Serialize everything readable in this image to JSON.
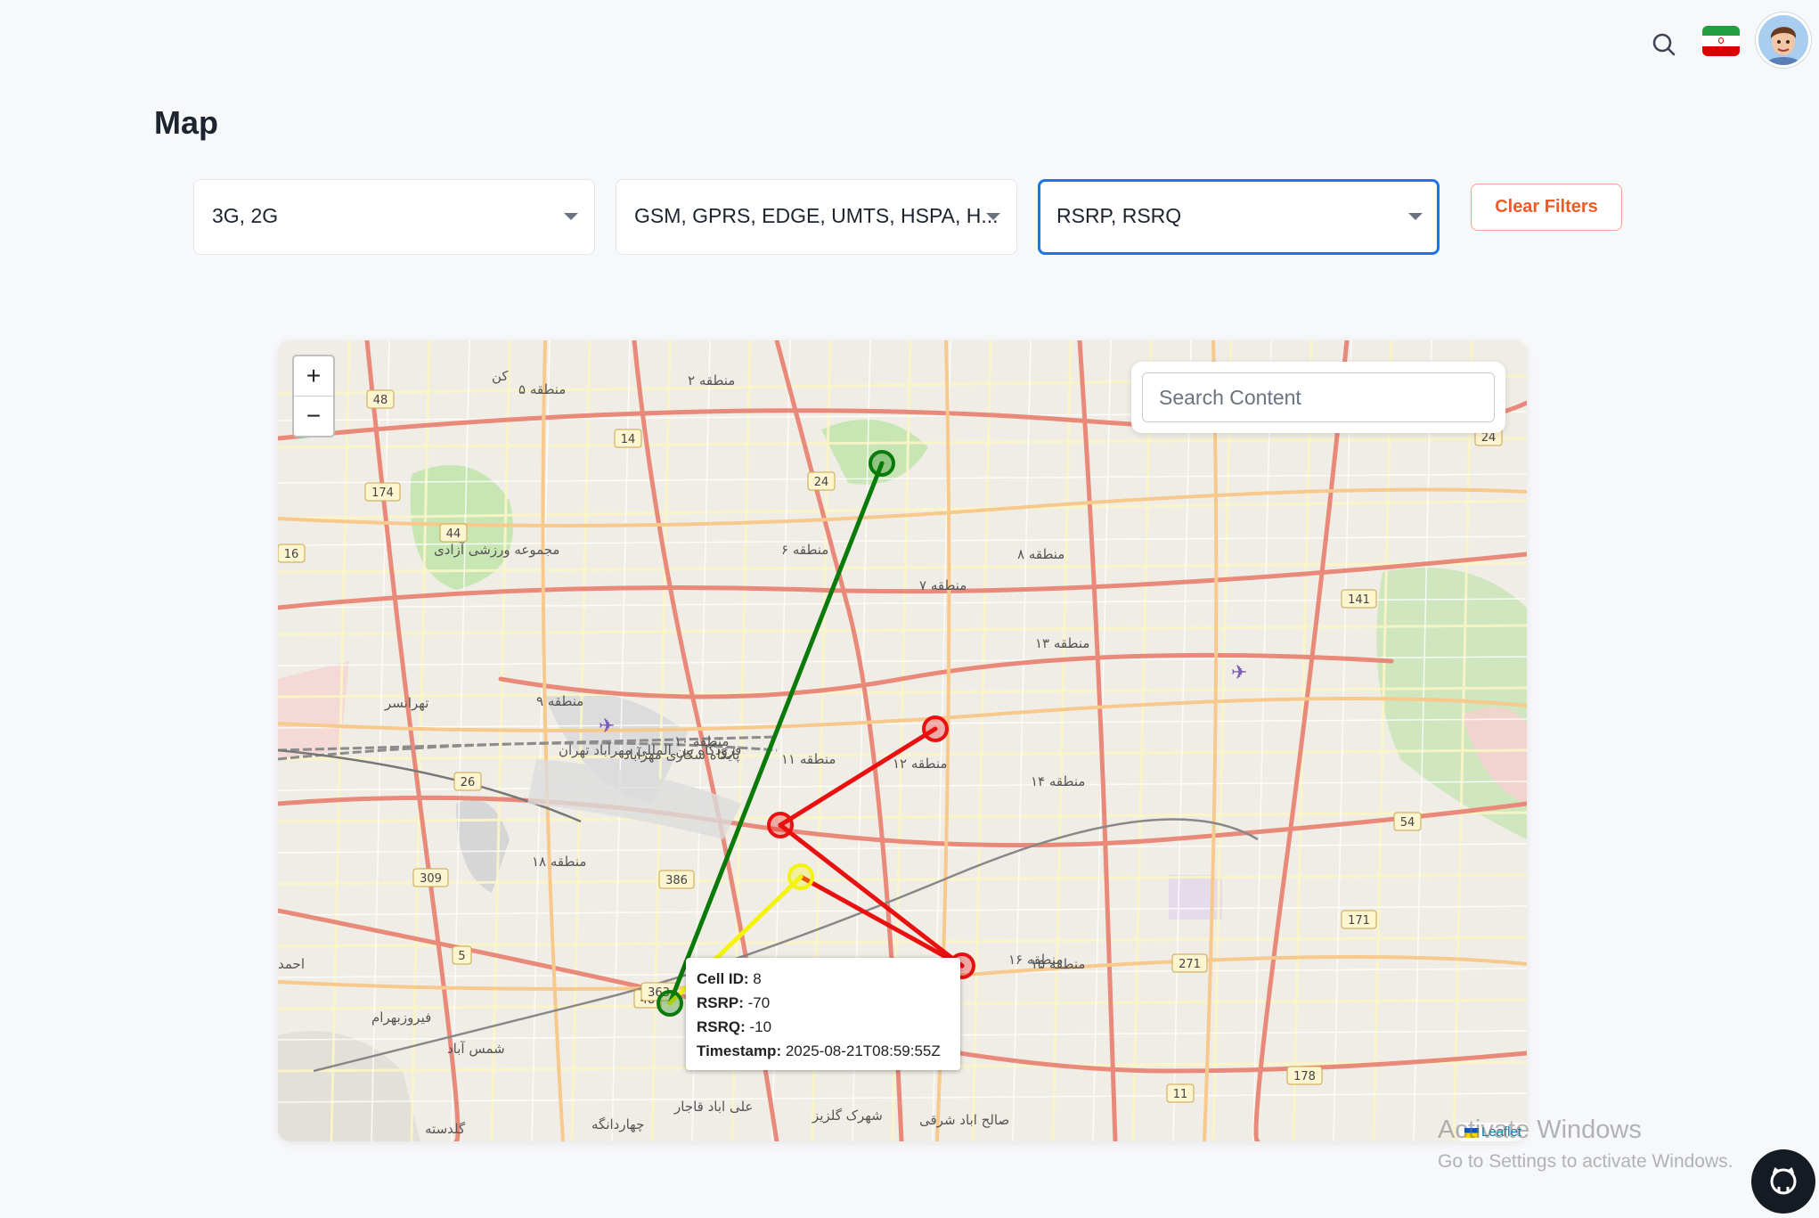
{
  "page": {
    "title": "Map"
  },
  "header": {
    "search_icon": "search-icon",
    "flag": "iran-flag",
    "avatar": "user-avatar"
  },
  "filters": [
    {
      "value": "3G, 2G",
      "focused": false
    },
    {
      "value": "GSM, GPRS, EDGE, UMTS, HSPA, H...",
      "focused": false
    },
    {
      "value": "RSRP, RSRQ",
      "focused": true
    }
  ],
  "clear_filters": "Clear Filters",
  "map": {
    "zoom_in": "+",
    "zoom_out": "−",
    "search_placeholder": "Search Content",
    "attribution": "Leaflet",
    "colors": {
      "green": "#0a7a0a",
      "red": "#e81010",
      "yellow": "#f4f40a"
    },
    "labels": [
      "منطقه ۲",
      "منطقه ۵",
      "منطقه ۶",
      "منطقه ۷",
      "منطقه ۸",
      "منطقه ۹",
      "منطقه ۱۰",
      "منطقه ۱۱",
      "منطقه ۱۲",
      "منطقه ۱۳",
      "منطقه ۱۴",
      "منطقه ۱۵",
      "منطقه ۱۶",
      "منطقه ۱۸",
      "تهرانسر",
      "مجموعه ورزشی آزادی",
      "فرودگاه بین المللی مهرآباد تهران",
      "پایگاه شکاری مهرآباد",
      "شمس آباد",
      "فیروزبهرام",
      "گلدسته",
      "علی اباد قاجار",
      "شهرک گلزیز",
      "صالح اباد شرقی",
      "چهاردانگه",
      "احمد",
      "کن"
    ],
    "road_numbers": [
      "48",
      "14",
      "24",
      "174",
      "44",
      "16",
      "26",
      "309",
      "386",
      "5",
      "48",
      "363",
      "11",
      "178",
      "271",
      "171",
      "54",
      "141",
      "24"
    ]
  },
  "tooltip": {
    "cell_id_label": "Cell ID:",
    "cell_id": "8",
    "rsrp_label": "RSRP:",
    "rsrp": "-70",
    "rsrq_label": "RSRQ:",
    "rsrq": "-10",
    "timestamp_label": "Timestamp:",
    "timestamp": "2025-08-21T08:59:55Z"
  },
  "watermark": {
    "line1": "Activate Windows",
    "line2": "Go to Settings to activate Windows."
  }
}
